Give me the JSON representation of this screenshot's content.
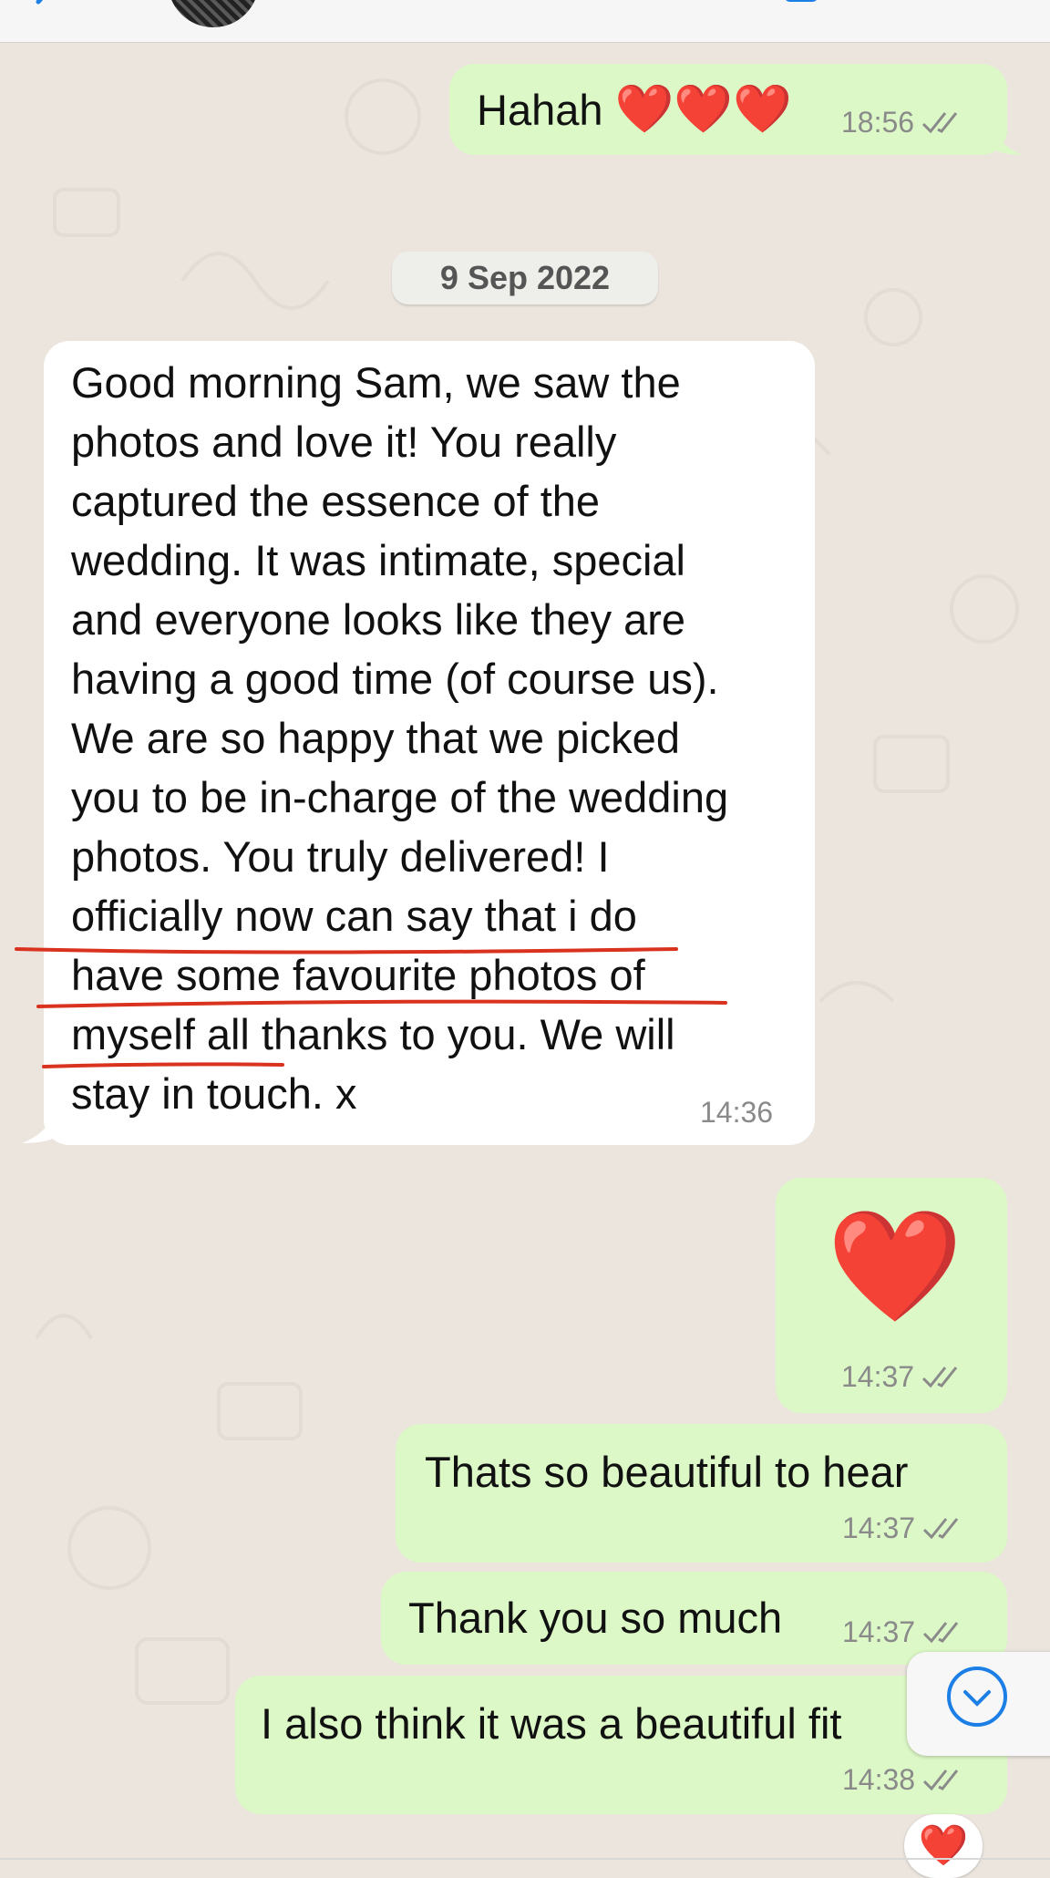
{
  "messages": [
    {
      "text": "Hahah",
      "emoji": "❤️❤️❤️",
      "time": "18:56"
    },
    {
      "date": "9 Sep 2022"
    },
    {
      "lines": [
        "Good morning Sam, we saw the",
        "photos and love it! You really",
        "captured the essence of the",
        "wedding. It was intimate, special",
        "and everyone looks like they are",
        "having a good time (of course us).",
        "We are so happy that we picked",
        "you to be in-charge of the wedding",
        "photos. You truly delivered! I",
        "officially now can say that i do",
        "have some favourite photos of",
        "myself all thanks to you. We will",
        "stay in touch. x"
      ],
      "time": "14:36"
    },
    {
      "emoji": "❤️",
      "time": "14:37"
    },
    {
      "text": "Thats so beautiful to hear",
      "time": "14:37"
    },
    {
      "text": "Thank you so much",
      "time": "14:37"
    },
    {
      "text": "I also think it was a beautiful fit",
      "time": "14:38"
    }
  ],
  "reaction": "❤️",
  "colors": {
    "outgoing_bubble": "#dcf8c6",
    "incoming_bubble": "#ffffff",
    "background": "#ebe5de",
    "underline": "#d9331f",
    "accent": "#1c7fe6"
  },
  "icons": [
    "back-chevron-icon",
    "video-call-icon",
    "phone-call-icon",
    "double-check-icon",
    "scroll-down-icon"
  ]
}
